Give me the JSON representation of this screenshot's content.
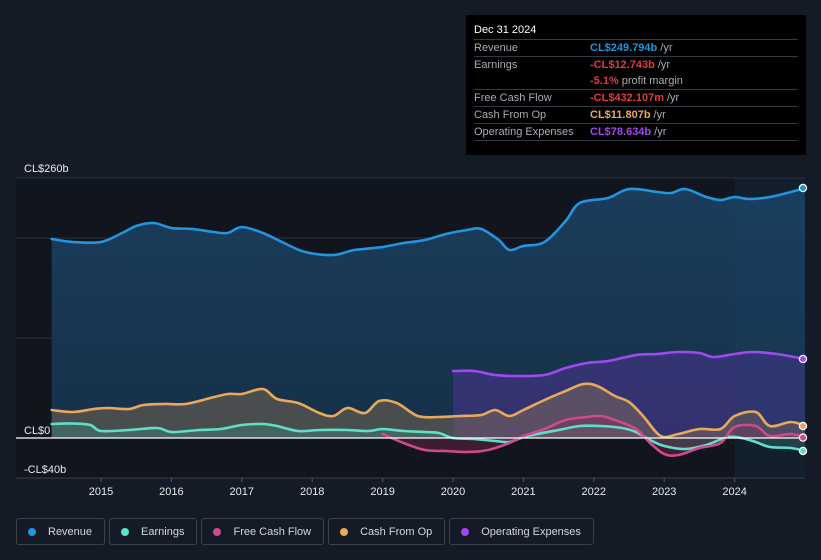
{
  "chart_data": {
    "type": "area",
    "title": "",
    "xlabel": "",
    "ylabel": "",
    "currency": "CL$",
    "unit": "b",
    "ylim": [
      -40,
      260
    ],
    "xlim": [
      2014.3,
      2025.0
    ],
    "y_ticks": [
      {
        "value": 260,
        "label": "CL$260b"
      },
      {
        "value": 0,
        "label": "CL$0"
      },
      {
        "value": -40,
        "label": "-CL$40b"
      }
    ],
    "gridlines": [
      260,
      200,
      100,
      0,
      -40
    ],
    "x_ticks": [
      {
        "value": 2015,
        "label": "2015"
      },
      {
        "value": 2016,
        "label": "2016"
      },
      {
        "value": 2017,
        "label": "2017"
      },
      {
        "value": 2018,
        "label": "2018"
      },
      {
        "value": 2019,
        "label": "2019"
      },
      {
        "value": 2020,
        "label": "2020"
      },
      {
        "value": 2021,
        "label": "2021"
      },
      {
        "value": 2022,
        "label": "2022"
      },
      {
        "value": 2023,
        "label": "2023"
      },
      {
        "value": 2024,
        "label": "2024"
      }
    ],
    "highlight_range": [
      2024.0,
      2025.0
    ],
    "legend_position": "bottom-left",
    "series": [
      {
        "name": "Revenue",
        "key": "revenue",
        "color": "#2394df",
        "points": [
          [
            2014.3,
            199
          ],
          [
            2014.6,
            196
          ],
          [
            2015.0,
            196
          ],
          [
            2015.3,
            205
          ],
          [
            2015.5,
            212
          ],
          [
            2015.75,
            215
          ],
          [
            2016.0,
            210
          ],
          [
            2016.3,
            209
          ],
          [
            2016.6,
            206
          ],
          [
            2016.8,
            205
          ],
          [
            2017.0,
            211
          ],
          [
            2017.3,
            205
          ],
          [
            2017.6,
            195
          ],
          [
            2017.9,
            186
          ],
          [
            2018.3,
            183
          ],
          [
            2018.6,
            188
          ],
          [
            2019.0,
            191
          ],
          [
            2019.3,
            195
          ],
          [
            2019.6,
            198
          ],
          [
            2019.9,
            204
          ],
          [
            2020.2,
            208
          ],
          [
            2020.4,
            209
          ],
          [
            2020.65,
            198
          ],
          [
            2020.8,
            188
          ],
          [
            2021.0,
            192
          ],
          [
            2021.3,
            196
          ],
          [
            2021.6,
            217
          ],
          [
            2021.8,
            235
          ],
          [
            2022.2,
            240
          ],
          [
            2022.5,
            249
          ],
          [
            2022.9,
            246
          ],
          [
            2023.1,
            245
          ],
          [
            2023.3,
            249
          ],
          [
            2023.6,
            241
          ],
          [
            2023.8,
            238
          ],
          [
            2024.0,
            241
          ],
          [
            2024.2,
            239
          ],
          [
            2024.5,
            241
          ],
          [
            2024.8,
            246
          ],
          [
            2025.0,
            250
          ]
        ]
      },
      {
        "name": "Earnings",
        "key": "earnings",
        "color": "#5ee0c8",
        "points": [
          [
            2014.3,
            14
          ],
          [
            2014.6,
            14.5
          ],
          [
            2014.85,
            13
          ],
          [
            2015.0,
            7
          ],
          [
            2015.4,
            8
          ],
          [
            2015.8,
            10
          ],
          [
            2016.0,
            6
          ],
          [
            2016.4,
            8
          ],
          [
            2016.7,
            9
          ],
          [
            2017.0,
            13
          ],
          [
            2017.3,
            14
          ],
          [
            2017.5,
            12
          ],
          [
            2017.8,
            7
          ],
          [
            2018.1,
            8
          ],
          [
            2018.5,
            8
          ],
          [
            2018.8,
            7
          ],
          [
            2019.0,
            9
          ],
          [
            2019.3,
            7
          ],
          [
            2019.6,
            6
          ],
          [
            2019.8,
            5
          ],
          [
            2020.0,
            0
          ],
          [
            2020.3,
            -1
          ],
          [
            2020.6,
            -3
          ],
          [
            2020.8,
            -4
          ],
          [
            2021.0,
            1
          ],
          [
            2021.2,
            4
          ],
          [
            2021.5,
            8
          ],
          [
            2021.8,
            12
          ],
          [
            2022.1,
            12
          ],
          [
            2022.4,
            10
          ],
          [
            2022.6,
            6
          ],
          [
            2022.8,
            -2
          ],
          [
            2023.0,
            -8
          ],
          [
            2023.3,
            -11
          ],
          [
            2023.6,
            -7
          ],
          [
            2023.9,
            1
          ],
          [
            2024.1,
            0
          ],
          [
            2024.3,
            -4
          ],
          [
            2024.5,
            -9
          ],
          [
            2024.8,
            -10
          ],
          [
            2025.0,
            -13
          ]
        ]
      },
      {
        "name": "Free Cash Flow",
        "key": "fcf",
        "color": "#d1498c",
        "points": [
          [
            2019.0,
            4
          ],
          [
            2019.3,
            -5
          ],
          [
            2019.6,
            -12
          ],
          [
            2019.9,
            -13
          ],
          [
            2020.2,
            -14
          ],
          [
            2020.5,
            -12
          ],
          [
            2020.8,
            -5
          ],
          [
            2021.0,
            2
          ],
          [
            2021.3,
            9
          ],
          [
            2021.6,
            18
          ],
          [
            2021.9,
            21
          ],
          [
            2022.1,
            22
          ],
          [
            2022.3,
            18
          ],
          [
            2022.6,
            9
          ],
          [
            2022.8,
            -5
          ],
          [
            2023.0,
            -16
          ],
          [
            2023.2,
            -17
          ],
          [
            2023.5,
            -10
          ],
          [
            2023.8,
            -5
          ],
          [
            2024.0,
            11
          ],
          [
            2024.3,
            12
          ],
          [
            2024.5,
            2
          ],
          [
            2024.8,
            4
          ],
          [
            2025.0,
            0.4
          ]
        ]
      },
      {
        "name": "Cash From Op",
        "key": "cfo",
        "color": "#e8a95b",
        "points": [
          [
            2014.3,
            28
          ],
          [
            2014.6,
            26
          ],
          [
            2014.9,
            29
          ],
          [
            2015.1,
            30
          ],
          [
            2015.4,
            29
          ],
          [
            2015.6,
            33
          ],
          [
            2015.9,
            34
          ],
          [
            2016.2,
            34
          ],
          [
            2016.5,
            39
          ],
          [
            2016.8,
            44
          ],
          [
            2017.0,
            44
          ],
          [
            2017.3,
            49
          ],
          [
            2017.5,
            39
          ],
          [
            2017.8,
            35
          ],
          [
            2018.1,
            25
          ],
          [
            2018.3,
            22
          ],
          [
            2018.5,
            30
          ],
          [
            2018.75,
            25
          ],
          [
            2018.95,
            37
          ],
          [
            2019.2,
            35
          ],
          [
            2019.5,
            22
          ],
          [
            2019.8,
            21
          ],
          [
            2020.1,
            22
          ],
          [
            2020.4,
            23
          ],
          [
            2020.6,
            28
          ],
          [
            2020.8,
            22
          ],
          [
            2021.0,
            28
          ],
          [
            2021.3,
            38
          ],
          [
            2021.6,
            47
          ],
          [
            2021.85,
            54
          ],
          [
            2022.05,
            52
          ],
          [
            2022.3,
            42
          ],
          [
            2022.5,
            36
          ],
          [
            2022.7,
            22
          ],
          [
            2022.95,
            2
          ],
          [
            2023.2,
            4
          ],
          [
            2023.5,
            9
          ],
          [
            2023.8,
            9
          ],
          [
            2024.0,
            22
          ],
          [
            2024.3,
            26
          ],
          [
            2024.5,
            12
          ],
          [
            2024.8,
            16
          ],
          [
            2025.0,
            12
          ]
        ]
      },
      {
        "name": "Operating Expenses",
        "key": "opex",
        "color": "#a248f0",
        "points": [
          [
            2020.0,
            67
          ],
          [
            2020.3,
            67
          ],
          [
            2020.6,
            63
          ],
          [
            2020.9,
            62
          ],
          [
            2021.3,
            63
          ],
          [
            2021.6,
            70
          ],
          [
            2021.9,
            75
          ],
          [
            2022.2,
            77
          ],
          [
            2022.6,
            83
          ],
          [
            2022.9,
            84
          ],
          [
            2023.2,
            86
          ],
          [
            2023.5,
            85
          ],
          [
            2023.7,
            81
          ],
          [
            2024.0,
            84
          ],
          [
            2024.25,
            86
          ],
          [
            2024.6,
            84
          ],
          [
            2025.0,
            79
          ]
        ]
      }
    ]
  },
  "tooltip": {
    "date": "Dec 31 2024",
    "rows": [
      {
        "label": "Revenue",
        "value": "CL$249.794b",
        "suffix": "/yr",
        "color": "#2394df"
      },
      {
        "label": "Earnings",
        "value": "-CL$12.743b",
        "suffix": "/yr",
        "color": "#e5383b"
      },
      {
        "label": "",
        "value": "-5.1%",
        "suffix": "profit margin",
        "color": "#e5383b"
      },
      {
        "label": "Free Cash Flow",
        "value": "-CL$432.107m",
        "suffix": "/yr",
        "color": "#e5383b"
      },
      {
        "label": "Cash From Op",
        "value": "CL$11.807b",
        "suffix": "/yr",
        "color": "#e8a95b"
      },
      {
        "label": "Operating Expenses",
        "value": "CL$78.634b",
        "suffix": "/yr",
        "color": "#a248f0"
      }
    ]
  },
  "legend": [
    {
      "label": "Revenue",
      "color": "#2394df"
    },
    {
      "label": "Earnings",
      "color": "#5ee0c8"
    },
    {
      "label": "Free Cash Flow",
      "color": "#d1498c"
    },
    {
      "label": "Cash From Op",
      "color": "#e8a95b"
    },
    {
      "label": "Operating Expenses",
      "color": "#a248f0"
    }
  ]
}
